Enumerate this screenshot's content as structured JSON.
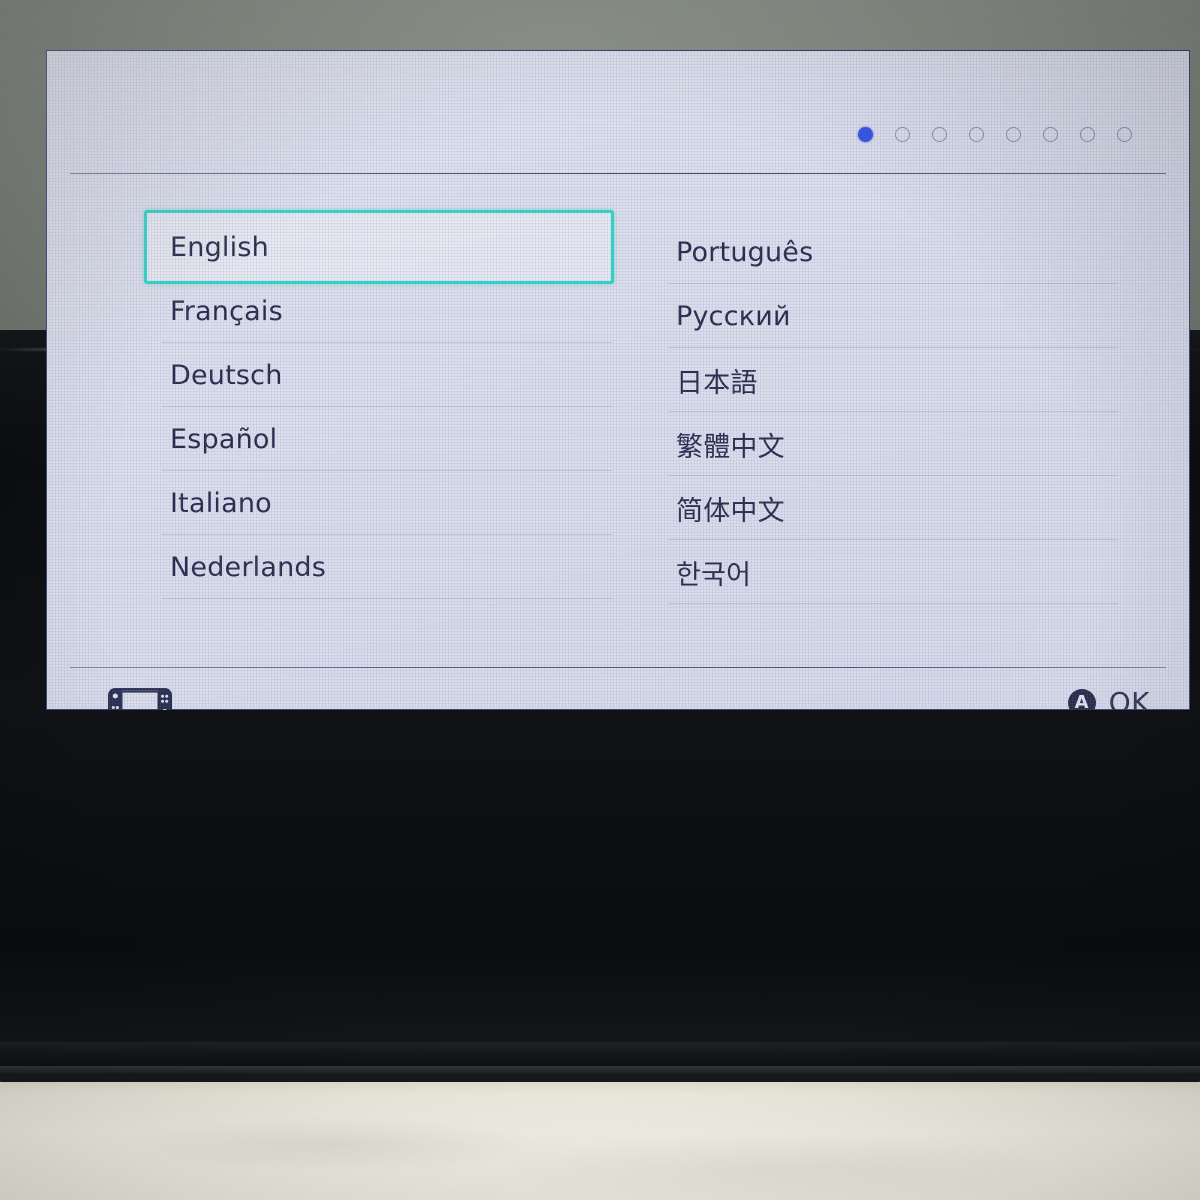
{
  "device": {
    "name": "Nintendo Switch",
    "screen_state": "language-selection"
  },
  "pagination": {
    "total": 8,
    "active_index": 0,
    "active_color": "#3354e6",
    "inactive_color": "#8b93b4"
  },
  "selection": {
    "selected_label": "English",
    "highlight_color": "#2fd6c6"
  },
  "languages": {
    "left_column": [
      {
        "label": "English"
      },
      {
        "label": "Français"
      },
      {
        "label": "Deutsch"
      },
      {
        "label": "Español"
      },
      {
        "label": "Italiano"
      },
      {
        "label": "Nederlands"
      }
    ],
    "right_column": [
      {
        "label": "Português"
      },
      {
        "label": "Русский"
      },
      {
        "label": "日本語"
      },
      {
        "label": "繁體中文"
      },
      {
        "label": "简体中文"
      },
      {
        "label": "한국어"
      }
    ]
  },
  "footer": {
    "console_icon": "switch-console-icon",
    "button_icon": "a-button-icon",
    "button_glyph": "A",
    "confirm_label": "OK"
  },
  "colors": {
    "screen_background": "#dde0ee",
    "text": "#232a4a",
    "separator": "#c2c6dc",
    "bezel": "#0b0d10",
    "wall": "#7e857d",
    "table": "#f3f0e6"
  }
}
